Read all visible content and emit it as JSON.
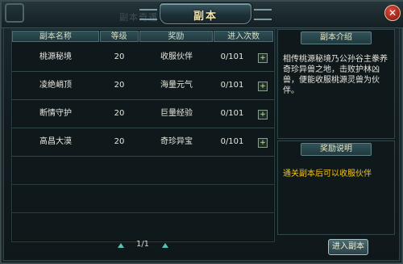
{
  "window": {
    "title": "副本",
    "ghost_title": "副本奇遇",
    "close_label": "✕"
  },
  "table": {
    "headers": [
      "副本名称",
      "等级",
      "奖励",
      "进入次数"
    ],
    "rows": [
      {
        "name": "桃源秘境",
        "level": "20",
        "reward": "收服伙伴",
        "entries": "0/101"
      },
      {
        "name": "凌绝峭顶",
        "level": "20",
        "reward": "海量元气",
        "entries": "0/101"
      },
      {
        "name": "断情守护",
        "level": "20",
        "reward": "巨量经验",
        "entries": "0/101"
      },
      {
        "name": "高昌大漠",
        "level": "20",
        "reward": "奇珍异宝",
        "entries": "0/101"
      }
    ],
    "row_icon": "plus-icon"
  },
  "pager": {
    "text": "1/1"
  },
  "intro": {
    "title": "副本介绍",
    "text": "相传桃源秘境乃公孙谷主豢养奇珍异兽之地，击败护林凶兽，便能收服桃源灵兽为伙伴。"
  },
  "reward_info": {
    "title": "奖励说明",
    "text": "通关副本后可以收服伙伴"
  },
  "buttons": {
    "enter": "进入副本"
  },
  "colors": {
    "gold_text": "#f5e7a8",
    "reward_text": "#f2c418",
    "accent_cyan": "#57c3b4",
    "close_red": "#c0392b"
  }
}
